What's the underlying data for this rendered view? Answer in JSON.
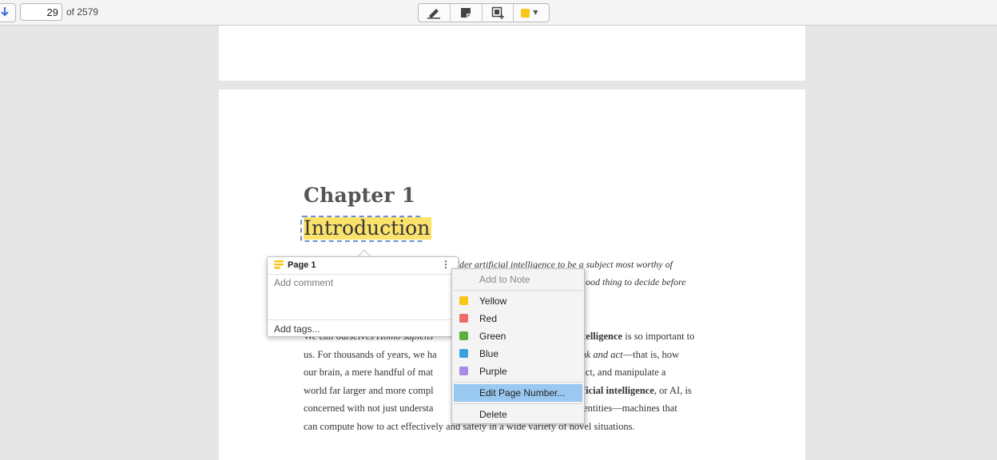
{
  "toolbar": {
    "page_number": "29",
    "page_total": "of 2579",
    "tools": [
      "pen-icon",
      "note-icon",
      "select-area-icon"
    ],
    "highlight_color": "#f7c817"
  },
  "document": {
    "chapter": "Chapter 1",
    "title": "Introduction",
    "quote_lines": [
      "sider artificial intelligence to be a subject most worthy of",
      "ood thing to decide before"
    ],
    "body_lines": [
      {
        "pre": "We call ourselves ",
        "em": "Homo sapiens",
        "mid": " ",
        "tail_bold": "ntelligence",
        "tail": " is so important to"
      },
      {
        "text": "us. For thousands of years, we ha",
        "em": "e think and act",
        "tail": "—that is, how"
      },
      {
        "text": "our brain, a mere handful of mat",
        "tail": "predict, and manipulate a"
      },
      {
        "text": "world far larger and more compl",
        "bold": "artificial intelligence",
        "tail": ", or AI, is"
      },
      {
        "text": "concerned with not just understa",
        "tail": "gent entities—machines that"
      },
      {
        "text": "can compute how to act effectively and safely in a wide variety of novel situations."
      }
    ]
  },
  "note_popup": {
    "title": "Page 1",
    "comment_placeholder": "Add comment",
    "tags_placeholder": "Add tags..."
  },
  "context_menu": {
    "add_to_note": "Add to Note",
    "colors": [
      {
        "label": "Yellow",
        "color": "#f7c817"
      },
      {
        "label": "Red",
        "color": "#f06a6a"
      },
      {
        "label": "Green",
        "color": "#5aaf3c"
      },
      {
        "label": "Blue",
        "color": "#3aa1e0"
      },
      {
        "label": "Purple",
        "color": "#a78be6"
      }
    ],
    "edit_page_number": "Edit Page Number...",
    "delete": "Delete"
  }
}
